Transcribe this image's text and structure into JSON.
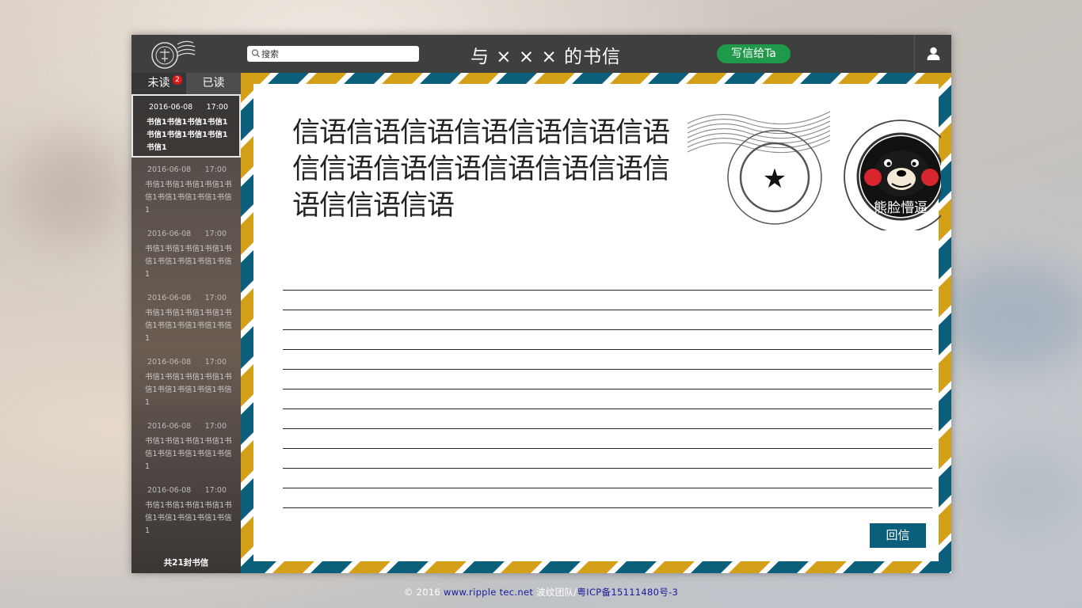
{
  "header": {
    "search_placeholder": "搜索",
    "title": "与 × × × 的书信",
    "write_button": "写信给Ta"
  },
  "sidebar": {
    "tab_unread": "未读",
    "unread_count": "2",
    "tab_read": "已读",
    "letters": [
      {
        "date": "2016-06-08",
        "time": "17:00",
        "preview": "书信1书信1书信1书信1书信1书信1书信1书信1书信1"
      },
      {
        "date": "2016-06-08",
        "time": "17:00",
        "preview": "书信1书信1书信1书信1书信1书信1书信1书信1书信1"
      },
      {
        "date": "2016-06-08",
        "time": "17:00",
        "preview": "书信1书信1书信1书信1书信1书信1书信1书信1书信1"
      },
      {
        "date": "2016-06-08",
        "time": "17:00",
        "preview": "书信1书信1书信1书信1书信1书信1书信1书信1书信1"
      },
      {
        "date": "2016-06-08",
        "time": "17:00",
        "preview": "书信1书信1书信1书信1书信1书信1书信1书信1书信1"
      },
      {
        "date": "2016-06-08",
        "time": "17:00",
        "preview": "书信1书信1书信1书信1书信1书信1书信1书信1书信1"
      },
      {
        "date": "2016-06-08",
        "time": "17:00",
        "preview": "书信1书信1书信1书信1书信1书信1书信1书信1书信1"
      }
    ],
    "total": "共21封书信"
  },
  "letter": {
    "message": "信语信语信语信语信语信语信语信信语信语信语信语信语信语信语信信语信语",
    "stamp_caption": "熊脸懵逼",
    "reply_button": "回信",
    "ruled_line_count": 12
  },
  "footer": {
    "copyright": "© 2016 ",
    "site": "www.ripple tec.net",
    "team": " 波纹团队/",
    "icp": "粤ICP备15111480号-3"
  },
  "colors": {
    "stripe_teal": "#0b5f7b",
    "stripe_gold": "#d4a017",
    "write_green": "#1f9a4a",
    "badge_red": "#e01818"
  }
}
